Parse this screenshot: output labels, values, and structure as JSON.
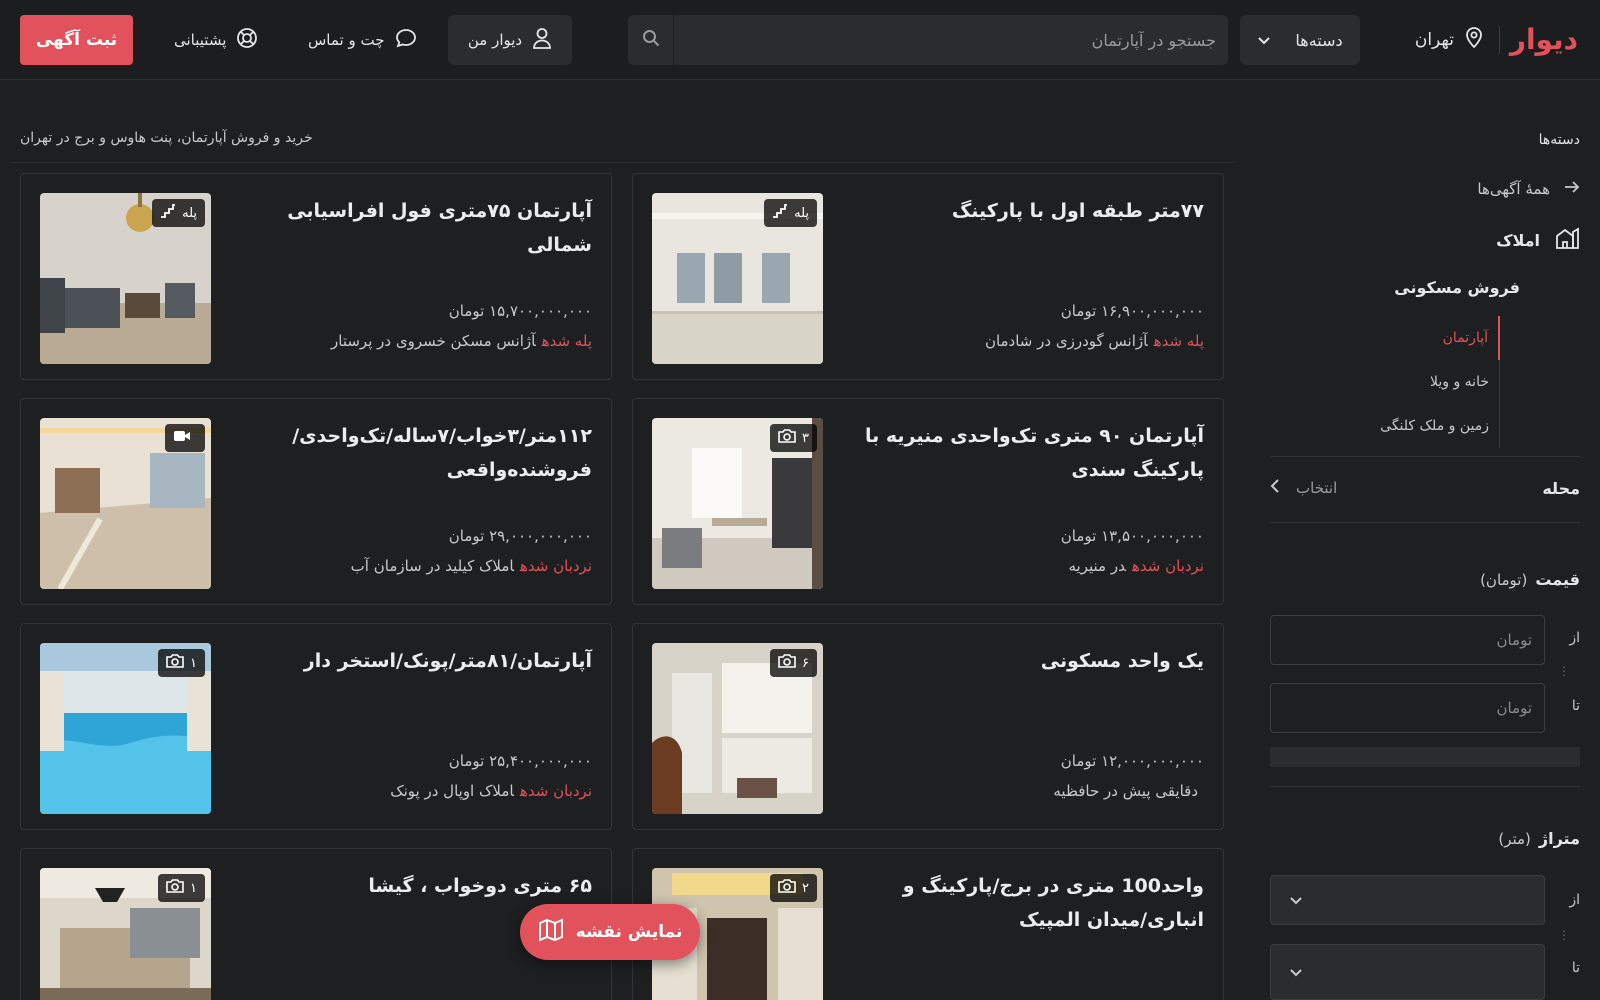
{
  "header": {
    "logo": "دیوار",
    "city": "تهران",
    "categories_label": "دسته‌ها",
    "search_placeholder": "جستجو در آپارتمان",
    "my_divar": "دیوار من",
    "chat": "چت و تماس",
    "support": "پشتیبانی",
    "post_ad": "ثبت آگهی"
  },
  "sidebar": {
    "title": "دسته‌ها",
    "all_ads": "همهٔ آگهی‌ها",
    "amlak": "املاک",
    "sub_category": "فروش مسکونی",
    "tree": [
      "آپارتمان",
      "خانه و ویلا",
      "زمین و ملک کلنگی"
    ],
    "neighborhood_label": "محله",
    "neighborhood_value": "انتخاب",
    "price_label": "قیمت",
    "price_unit": "(تومان)",
    "from_label": "از",
    "to_label": "تا",
    "price_placeholder": "تومان",
    "area_label": "متراژ",
    "area_unit": "(متر)"
  },
  "main": {
    "breadcrumb": "خرید و فروش آپارتمان، پنت هاوس و برج در تهران",
    "listings": [
      {
        "title": "۷۷متر طبقه اول با پارکینگ",
        "price": "۱۶,۹۰۰,۰۰۰,۰۰۰ تومان",
        "tag": "پله شده",
        "meta": "آژانس گودرزی در شادمان",
        "badge": "پله",
        "badge_icon": "stairs-icon"
      },
      {
        "title": "آپارتمان ۷۵متری فول افراسیابی شمالی",
        "price": "۱۵,۷۰۰,۰۰۰,۰۰۰ تومان",
        "tag": "پله شده",
        "meta": "آژانس مسکن خسروی در پرستار",
        "badge": "پله",
        "badge_icon": "stairs-icon"
      },
      {
        "title": "آپارتمان ۹۰ متری تک‌واحدی منیریه با پارکینگ سندی",
        "price": "۱۳,۵۰۰,۰۰۰,۰۰۰ تومان",
        "tag": "نردبان شده",
        "meta": "در منیریه",
        "badge": "۳",
        "badge_icon": "camera-icon"
      },
      {
        "title": "۱۱۲متر/۳خواب/۷ساله/تک‌واحدی/فروشنده‌واقعی",
        "price": "۲۹,۰۰۰,۰۰۰,۰۰۰ تومان",
        "tag": "نردبان شده",
        "meta": "املاک کیلید در سازمان آب",
        "badge": "",
        "badge_icon": "video-icon"
      },
      {
        "title": "یک واحد مسکونی",
        "price": "۱۲,۰۰۰,۰۰۰,۰۰۰ تومان",
        "tag": "",
        "meta": "دقایقی پیش در حافظیه",
        "badge": "۶",
        "badge_icon": "camera-icon"
      },
      {
        "title": "آپارتمان/۸۱متر/پونک/استخر دار",
        "price": "۲۵,۴۰۰,۰۰۰,۰۰۰ تومان",
        "tag": "نردبان شده",
        "meta": "املاک اوپال در پونک",
        "badge": "۱",
        "badge_icon": "camera-icon"
      },
      {
        "title": "واحد100 متری در برج/پارکینگ و انباری/میدان المپیک",
        "price": "",
        "tag": "",
        "meta": "",
        "badge": "۲",
        "badge_icon": "camera-icon"
      },
      {
        "title": "۶۵ متری دوخواب ، گیشا",
        "price": "",
        "tag": "",
        "meta": "",
        "badge": "۱",
        "badge_icon": "camera-icon"
      }
    ],
    "map_button": "نمایش نقشه"
  },
  "colors": {
    "accent": "#e2525c",
    "background": "#1e1f20",
    "surface": "#2b2c2e"
  }
}
